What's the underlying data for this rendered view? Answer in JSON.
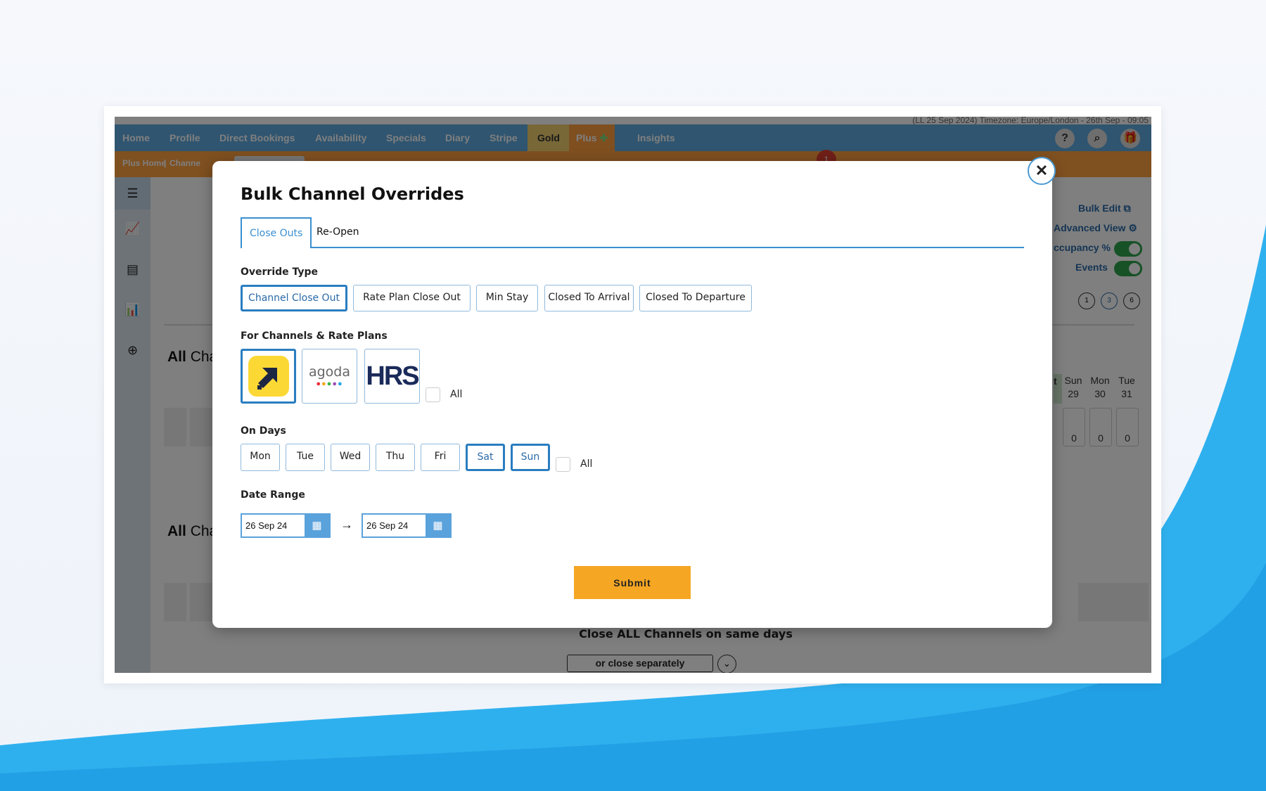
{
  "top_info": "(LL 25 Sep 2024)   Timezone: Europe/London - 26th Sep - 09:05",
  "nav": {
    "items": [
      "Home",
      "Profile",
      "Direct Bookings",
      "Availability",
      "Specials",
      "Diary",
      "Stripe",
      "Gold",
      "Plus",
      "Insights"
    ],
    "icons": [
      "help-icon",
      "search-icon",
      "gift-icon"
    ]
  },
  "subnav": {
    "items": [
      "Plus Home",
      "Channe"
    ],
    "badge": "1"
  },
  "background": {
    "bulk_edit": "Bulk Edit",
    "advanced_view": "Advanced View",
    "occupancy": "ccupancy %",
    "events": "Events",
    "views": [
      "1",
      "3",
      "6"
    ],
    "section_a": "All",
    "section_a2": "Cha",
    "section_b": "All",
    "section_b2": "Cha",
    "days": [
      {
        "d": "Sun",
        "n": "29",
        "v": "0"
      },
      {
        "d": "Mon",
        "n": "30",
        "v": "0"
      },
      {
        "d": "Tue",
        "n": "31",
        "v": "0"
      }
    ],
    "partial_day": "t",
    "close_all": "Close ALL Channels on same days",
    "close_separately": "or close separately"
  },
  "modal": {
    "title": "Bulk Channel Overrides",
    "tabs": [
      "Close Outs",
      "Re-Open"
    ],
    "override_label": "Override Type",
    "override_types": [
      "Channel Close Out",
      "Rate Plan Close Out",
      "Min Stay",
      "Closed To Arrival",
      "Closed To Departure"
    ],
    "override_selected": "Channel Close Out",
    "channels_label": "For Channels & Rate Plans",
    "channels": [
      "Expedia",
      "agoda",
      "HRS"
    ],
    "channels_selected": [
      "Expedia"
    ],
    "all_label": "All",
    "days_label": "On Days",
    "days": [
      "Mon",
      "Tue",
      "Wed",
      "Thu",
      "Fri",
      "Sat",
      "Sun"
    ],
    "days_selected": [
      "Sat",
      "Sun"
    ],
    "days_all": "All",
    "date_label": "Date Range",
    "date_from": "26 Sep 24",
    "date_to": "26 Sep 24",
    "submit": "Submit"
  },
  "colors": {
    "accent": "#2a7dc0",
    "submit": "#f5a623",
    "nav": "#5eaae0",
    "subnav": "#ffa040"
  }
}
